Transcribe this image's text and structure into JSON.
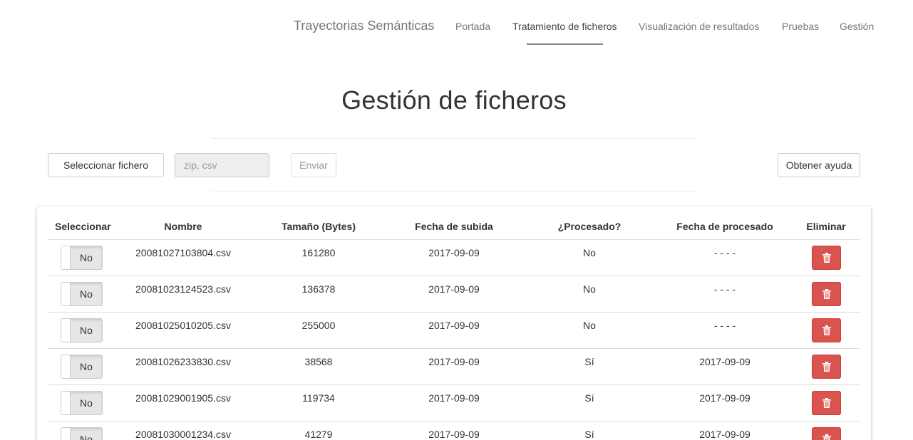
{
  "nav": {
    "brand": "Trayectorias Semánticas",
    "items": [
      {
        "label": "Portada"
      },
      {
        "label": "Tratamiento de ficheros"
      },
      {
        "label": "Visualización de resultados"
      },
      {
        "label": "Pruebas"
      },
      {
        "label": "Gestión"
      }
    ],
    "active_item": "Tratamiento de ficheros"
  },
  "page": {
    "title": "Gestión de ficheros"
  },
  "upload": {
    "select_label": "Seleccionar fichero",
    "file_placeholder": "zip, csv",
    "send_label": "Enviar",
    "help_label": "Obtener ayuda"
  },
  "table": {
    "headers": [
      "Seleccionar",
      "Nombre",
      "Tamaño (Bytes)",
      "Fecha de subida",
      "¿Procesado?",
      "Fecha de procesado",
      "Eliminar"
    ],
    "rows": [
      {
        "toggle": "No",
        "name": "20081027103804.csv",
        "size": "161280",
        "uploaded": "2017-09-09",
        "processed": "No",
        "processed_date": "- - - -"
      },
      {
        "toggle": "No",
        "name": "20081023124523.csv",
        "size": "136378",
        "uploaded": "2017-09-09",
        "processed": "No",
        "processed_date": "- - - -"
      },
      {
        "toggle": "No",
        "name": "20081025010205.csv",
        "size": "255000",
        "uploaded": "2017-09-09",
        "processed": "No",
        "processed_date": "- - - -"
      },
      {
        "toggle": "No",
        "name": "20081026233830.csv",
        "size": "38568",
        "uploaded": "2017-09-09",
        "processed": "Sí",
        "processed_date": "2017-09-09"
      },
      {
        "toggle": "No",
        "name": "20081029001905.csv",
        "size": "119734",
        "uploaded": "2017-09-09",
        "processed": "Sí",
        "processed_date": "2017-09-09"
      },
      {
        "toggle": "No",
        "name": "20081030001234.csv",
        "size": "41279",
        "uploaded": "2017-09-09",
        "processed": "Sí",
        "processed_date": "2017-09-09"
      }
    ]
  },
  "colors": {
    "danger": "#d9534f",
    "nav_text": "#777777",
    "border": "#dddddd"
  },
  "icons": {
    "delete": "trash-icon"
  }
}
